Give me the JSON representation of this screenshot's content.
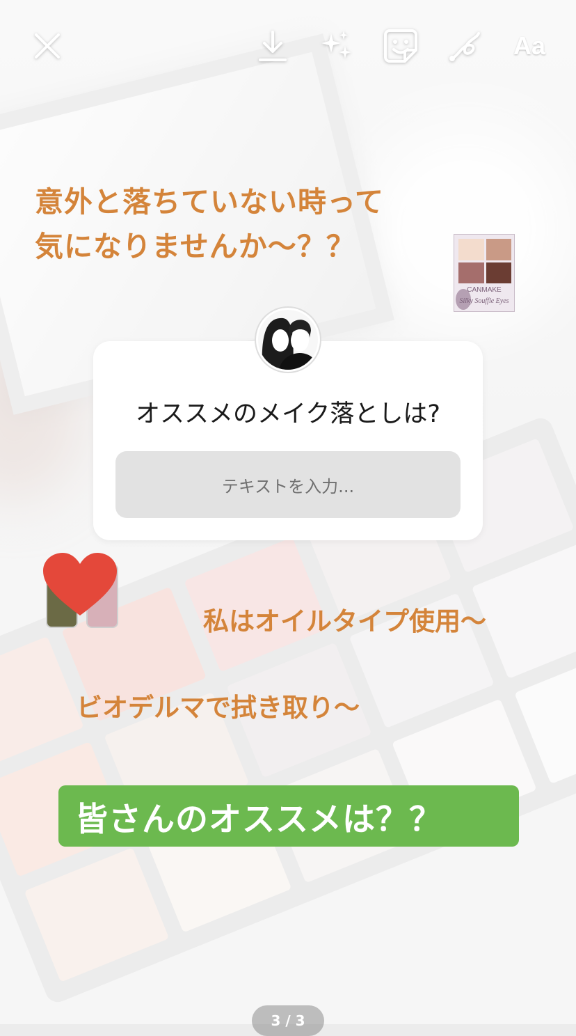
{
  "toolbar": {
    "close_icon": "close-icon",
    "download_icon": "download-icon",
    "effects_icon": "sparkles-icon",
    "sticker_icon": "sticker-icon",
    "draw_icon": "draw-icon",
    "text_tool_label": "Aa"
  },
  "headline": {
    "line1": "意外と落ちていない時って",
    "line2": "気になりませんか〜？？"
  },
  "sticker_product": {
    "brand": "CANMAKE",
    "subtitle": "Silky Souffle Eyes"
  },
  "question_sticker": {
    "question": "オススメのメイク落としは?",
    "placeholder": "テキストを入力..."
  },
  "captions": {
    "oil": "私はオイルタイプ使用〜",
    "bioderma": "ビオデルマで拭き取り〜"
  },
  "cta": {
    "label": "皆さんのオススメは？？"
  },
  "pager": {
    "label": "3 / 3"
  },
  "colors": {
    "orange_text": "#d4843a",
    "cta_green": "#6cb94f",
    "heart_red": "#e4483a"
  }
}
